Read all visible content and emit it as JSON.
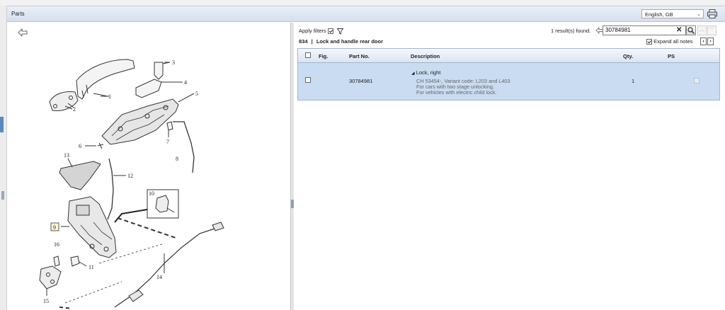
{
  "header": {
    "title": "Parts",
    "language": "English, GB"
  },
  "diagram": {
    "callouts": [
      "1",
      "2",
      "3",
      "4",
      "5",
      "6",
      "7",
      "8",
      "9",
      "10",
      "11",
      "12",
      "13",
      "14",
      "15",
      "16"
    ]
  },
  "toolbar": {
    "apply_filters_label": "Apply filters",
    "apply_filters_checked": true,
    "result_count": "1 result(s) found.",
    "search_value": "30784981",
    "clear_label": "✕"
  },
  "breadcrumb": {
    "group": "834",
    "separator": "|",
    "title": "Lock and handle rear door"
  },
  "expand": {
    "label": "Expand all notes",
    "checked": true
  },
  "table": {
    "columns": {
      "fig": "Fig.",
      "part_no": "Part No.",
      "description": "Description",
      "qty": "Qty.",
      "ps": "PS"
    },
    "rows": [
      {
        "fig": "",
        "part_no": "30784981",
        "description": "Lock, right",
        "notes": [
          "CH 53454-, Variant code: L203 and L403",
          "For cars with two stage unlocking.",
          "For vehicles with electric child lock."
        ],
        "qty": "1"
      }
    ]
  },
  "colors": {
    "header_bg": "#d5dfed",
    "selected_row": "#c9dcf2",
    "table_border": "#9fb5cf"
  }
}
